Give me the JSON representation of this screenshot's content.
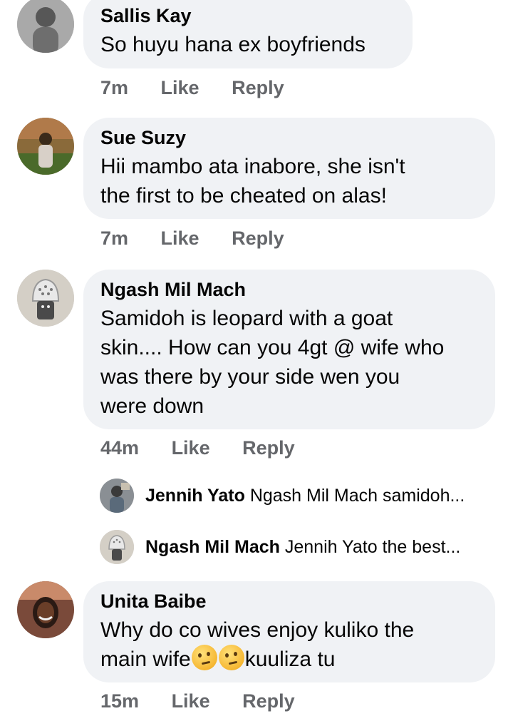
{
  "comments": [
    {
      "author": "Sallis Kay",
      "lines": [
        "So huyu hana ex boyfriends"
      ],
      "time": "7m",
      "like": "Like",
      "reply": "Reply"
    },
    {
      "author": "Sue Suzy",
      "lines": [
        "Hii mambo ata inabore, she isn't",
        "the first to be cheated on alas!"
      ],
      "time": "7m",
      "like": "Like",
      "reply": "Reply"
    },
    {
      "author": "Ngash Mil Mach",
      "lines": [
        "Samidoh is leopard with a goat",
        "skin.... How can you 4gt @ wife who",
        "was there by your side wen you",
        "were down"
      ],
      "time": "44m",
      "like": "Like",
      "reply": "Reply",
      "replies": [
        {
          "author": "Jennih Yato",
          "preview": "Ngash Mil Mach samidoh..."
        },
        {
          "author": "Ngash Mil Mach",
          "preview": "Jennih Yato the best..."
        }
      ]
    },
    {
      "author": "Unita Baibe",
      "line1": "Why do co wives enjoy kuliko the",
      "line2_before": "main wife",
      "emoji_icons": [
        "thinking-face-icon",
        "thinking-face-icon"
      ],
      "line2_after": "kuuliza tu",
      "time": "15m",
      "like": "Like",
      "reply": "Reply"
    }
  ],
  "colors": {
    "bubble": "#f0f2f5",
    "meta": "#65676b",
    "text": "#050505"
  }
}
